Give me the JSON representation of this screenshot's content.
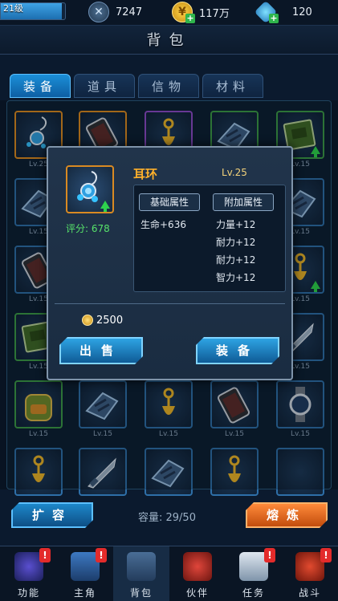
{
  "topbar": {
    "level_text": "21级",
    "level_progress": 0.95,
    "power": "7247",
    "coins": "117万",
    "gems": "120"
  },
  "page_title": "背包",
  "tabs": [
    {
      "label": "装备",
      "active": true
    },
    {
      "label": "道具",
      "active": false
    },
    {
      "label": "信物",
      "active": false
    },
    {
      "label": "材料",
      "active": false
    }
  ],
  "grid": {
    "rows": [
      [
        {
          "icon": "earring-icon",
          "level": "Lv.25",
          "quality": "orange",
          "upgrade": false
        },
        {
          "icon": "phone-icon",
          "level": "",
          "quality": "orange",
          "upgrade": false
        },
        {
          "icon": "tassel-icon",
          "level": "",
          "quality": "purple",
          "upgrade": false
        },
        {
          "icon": "gauntlet-icon",
          "level": "",
          "quality": "green",
          "upgrade": false
        },
        {
          "icon": "book-icon",
          "level": "Lv.15",
          "quality": "green",
          "upgrade": true
        }
      ],
      [
        {
          "icon": "gauntlet-icon",
          "level": "Lv.15",
          "quality": "blue",
          "upgrade": false
        },
        {
          "icon": "",
          "level": "",
          "quality": "blue",
          "upgrade": false
        },
        {
          "icon": "",
          "level": "",
          "quality": "blue",
          "upgrade": false
        },
        {
          "icon": "",
          "level": "",
          "quality": "blue",
          "upgrade": false
        },
        {
          "icon": "gauntlet-icon",
          "level": "Lv.15",
          "quality": "blue",
          "upgrade": false
        }
      ],
      [
        {
          "icon": "phone-icon",
          "level": "Lv.15",
          "quality": "blue",
          "upgrade": false
        },
        {
          "icon": "",
          "level": "",
          "quality": "blue",
          "upgrade": false
        },
        {
          "icon": "",
          "level": "",
          "quality": "blue",
          "upgrade": false
        },
        {
          "icon": "",
          "level": "",
          "quality": "blue",
          "upgrade": false
        },
        {
          "icon": "tassel-icon",
          "level": "Lv.15",
          "quality": "blue",
          "upgrade": true
        }
      ],
      [
        {
          "icon": "book-icon",
          "level": "Lv.15",
          "quality": "green",
          "upgrade": false
        },
        {
          "icon": "",
          "level": "",
          "quality": "blue",
          "upgrade": false
        },
        {
          "icon": "",
          "level": "",
          "quality": "blue",
          "upgrade": false
        },
        {
          "icon": "",
          "level": "",
          "quality": "blue",
          "upgrade": false
        },
        {
          "icon": "dagger-icon",
          "level": "Lv.15",
          "quality": "blue",
          "upgrade": false
        }
      ],
      [
        {
          "icon": "backpack-icon",
          "level": "Lv.15",
          "quality": "green",
          "upgrade": false
        },
        {
          "icon": "gauntlet-icon",
          "level": "Lv.15",
          "quality": "blue",
          "upgrade": false
        },
        {
          "icon": "tassel-icon",
          "level": "Lv.15",
          "quality": "blue",
          "upgrade": false
        },
        {
          "icon": "phone-icon",
          "level": "Lv.15",
          "quality": "blue",
          "upgrade": false
        },
        {
          "icon": "watch-icon",
          "level": "Lv.15",
          "quality": "blue",
          "upgrade": false
        }
      ],
      [
        {
          "icon": "tassel-icon",
          "level": "",
          "quality": "blue",
          "upgrade": false
        },
        {
          "icon": "dagger-icon",
          "level": "",
          "quality": "blue",
          "upgrade": false
        },
        {
          "icon": "gauntlet-icon",
          "level": "",
          "quality": "blue",
          "upgrade": false
        },
        {
          "icon": "tassel-icon",
          "level": "",
          "quality": "blue",
          "upgrade": false
        },
        {
          "icon": "",
          "level": "",
          "quality": "blue",
          "upgrade": false
        }
      ]
    ]
  },
  "popup": {
    "item_name": "耳环",
    "item_level": "Lv.25",
    "score": "评分: 678",
    "base_header": "基础属性",
    "extra_header": "附加属性",
    "base_attrs": [
      "生命+636"
    ],
    "extra_attrs": [
      "力量+12",
      "耐力+12",
      "耐力+12",
      "智力+12"
    ],
    "price": "2500",
    "sell_label": "出售",
    "equip_label": "装备"
  },
  "actions": {
    "expand_label": "扩容",
    "capacity": "容量: 29/50",
    "smelt_label": "熔炼"
  },
  "bottom_nav": [
    {
      "label": "功能",
      "icon": "globe-icon",
      "badge": "!",
      "active": false
    },
    {
      "label": "主角",
      "icon": "team-icon",
      "badge": "!",
      "active": false
    },
    {
      "label": "背包",
      "icon": "bag-icon",
      "badge": "",
      "active": true
    },
    {
      "label": "伙伴",
      "icon": "hero-icon",
      "badge": "",
      "active": false
    },
    {
      "label": "任务",
      "icon": "megaphone-icon",
      "badge": "!",
      "active": false
    },
    {
      "label": "战斗",
      "icon": "helmet-icon",
      "badge": "!",
      "active": false
    }
  ],
  "colors": {
    "accent_blue": "#1b8fd8",
    "quality_orange": "#d98a22",
    "quality_purple": "#8b4bc7",
    "quality_green": "#3b9a48",
    "smelt_orange": "#ff8a3a",
    "score_green": "#57e26a",
    "badge_red": "#e32b2b"
  }
}
